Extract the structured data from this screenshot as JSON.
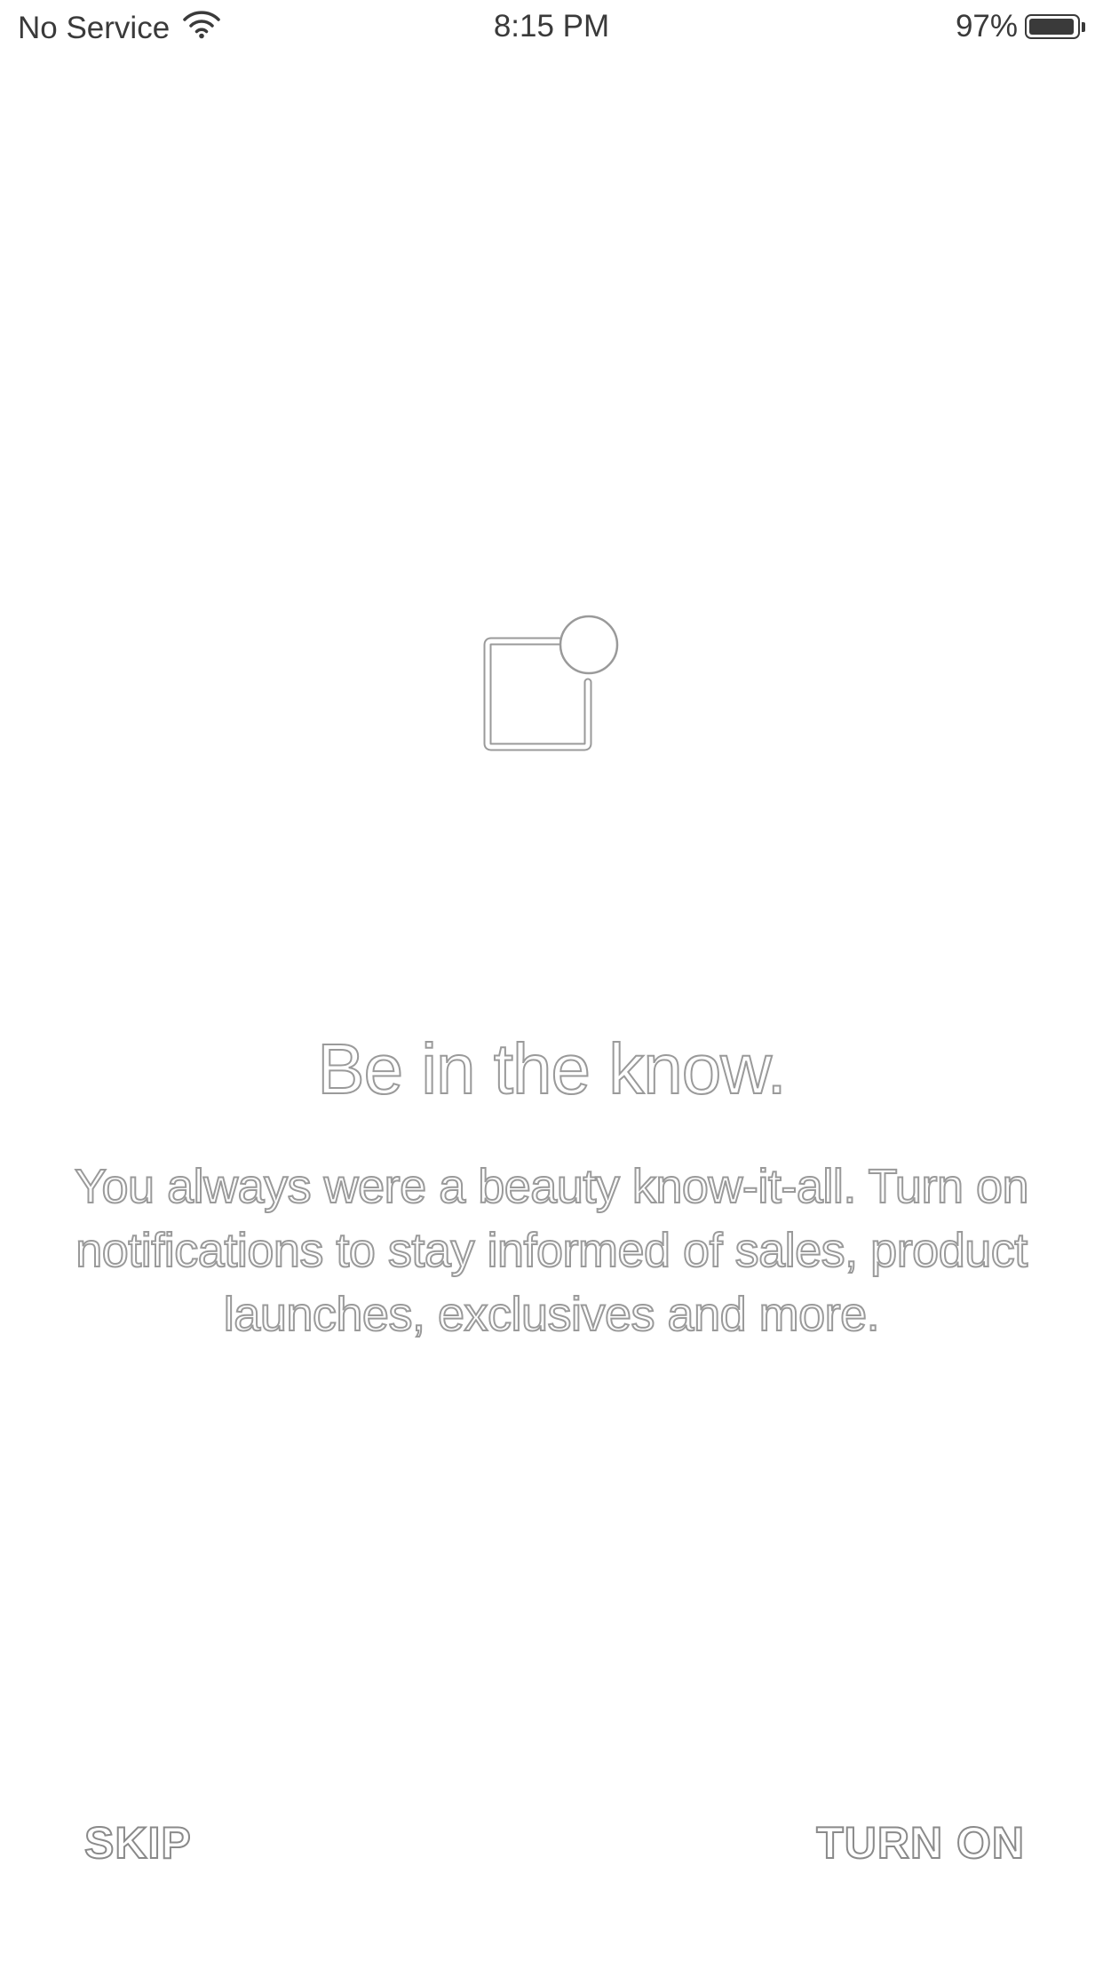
{
  "status_bar": {
    "carrier": "No Service",
    "time": "8:15 PM",
    "battery_percent_text": "97%",
    "battery_level": 0.97
  },
  "icons": {
    "wifi": "wifi-icon",
    "battery": "battery-icon",
    "notification": "notification-badge-icon"
  },
  "content": {
    "headline": "Be in the know.",
    "body": "You always were a beauty know-it-all. Turn on notifications to stay informed of sales, product launches, exclusives and more."
  },
  "actions": {
    "skip_label": "SKIP",
    "turn_on_label": "TURN ON"
  },
  "colors": {
    "text_outline": "#9a9a9a",
    "background": "#ffffff",
    "status_text": "#3a3a3a"
  }
}
